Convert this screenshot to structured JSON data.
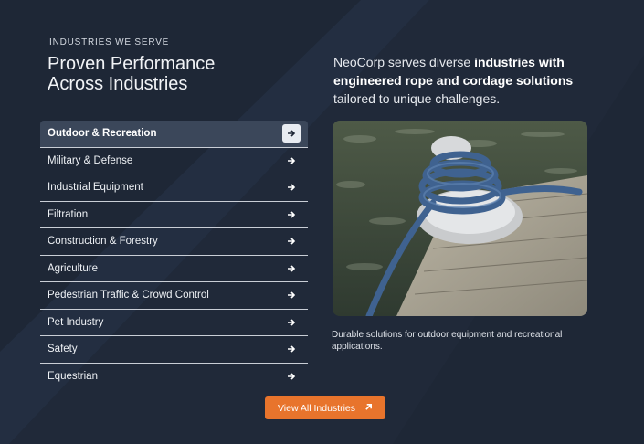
{
  "section": {
    "eyebrow": "INDUSTRIES WE SERVE",
    "title_line1": "Proven Performance",
    "title_line2": "Across Industries",
    "intro_prefix": "NeoCorp serves diverse ",
    "intro_bold": "industries with engineered rope and cordage solutions",
    "intro_suffix": " tailored to unique challenges."
  },
  "industries": [
    {
      "label": "Outdoor & Recreation",
      "active": true
    },
    {
      "label": "Military & Defense"
    },
    {
      "label": "Industrial Equipment"
    },
    {
      "label": "Filtration"
    },
    {
      "label": "Construction & Forestry"
    },
    {
      "label": "Agriculture"
    },
    {
      "label": "Pedestrian Traffic & Crowd Control"
    },
    {
      "label": "Pet Industry"
    },
    {
      "label": "Safety"
    },
    {
      "label": "Equestrian"
    }
  ],
  "feature": {
    "image_icon": "rope-on-cleat-photo",
    "caption": "Durable solutions for outdoor equipment and recreational applications."
  },
  "cta": {
    "label": "View All Industries",
    "icon": "arrow-up-right-icon"
  },
  "colors": {
    "background": "#1e2736",
    "active_item": "#3b475a",
    "accent": "#e8742c"
  }
}
